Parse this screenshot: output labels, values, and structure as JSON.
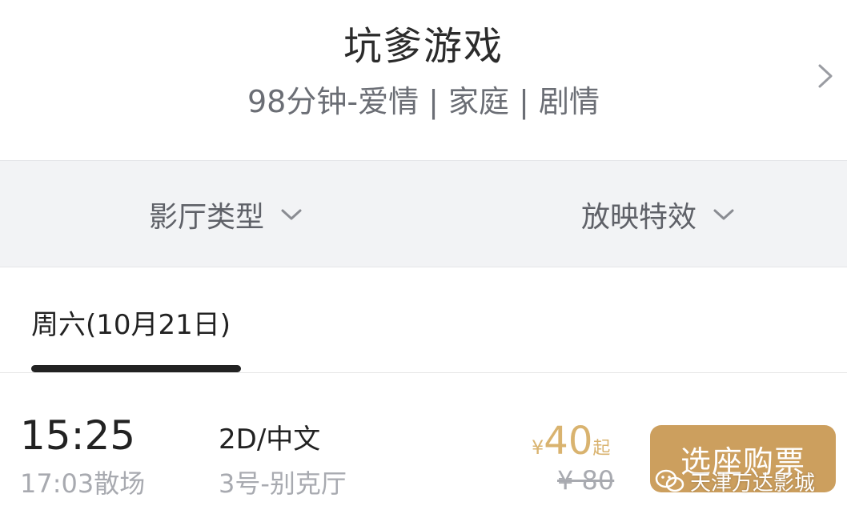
{
  "movie": {
    "title": "坑爹游戏",
    "meta": "98分钟-爱情 | 家庭 | 剧情"
  },
  "filters": {
    "hall_type": "影厅类型",
    "screening_effect": "放映特效"
  },
  "date_tab": {
    "label": "周六(10月21日)"
  },
  "session": {
    "start": "15:25",
    "end": "17:03散场",
    "version": "2D/中文",
    "hall": "3号-别克厅",
    "price_symbol": "¥",
    "price": "40",
    "price_suffix": "起",
    "original_price": "¥ 80",
    "buy_label": "选座购票"
  },
  "watermark": {
    "text": "天津万达影城",
    "icon": "wechat-icon"
  },
  "colors": {
    "accent_gold": "#cc9f5e",
    "price_gold": "#d9b36f",
    "filter_bg": "#f2f3f5",
    "muted_text": "#a8aab0"
  }
}
